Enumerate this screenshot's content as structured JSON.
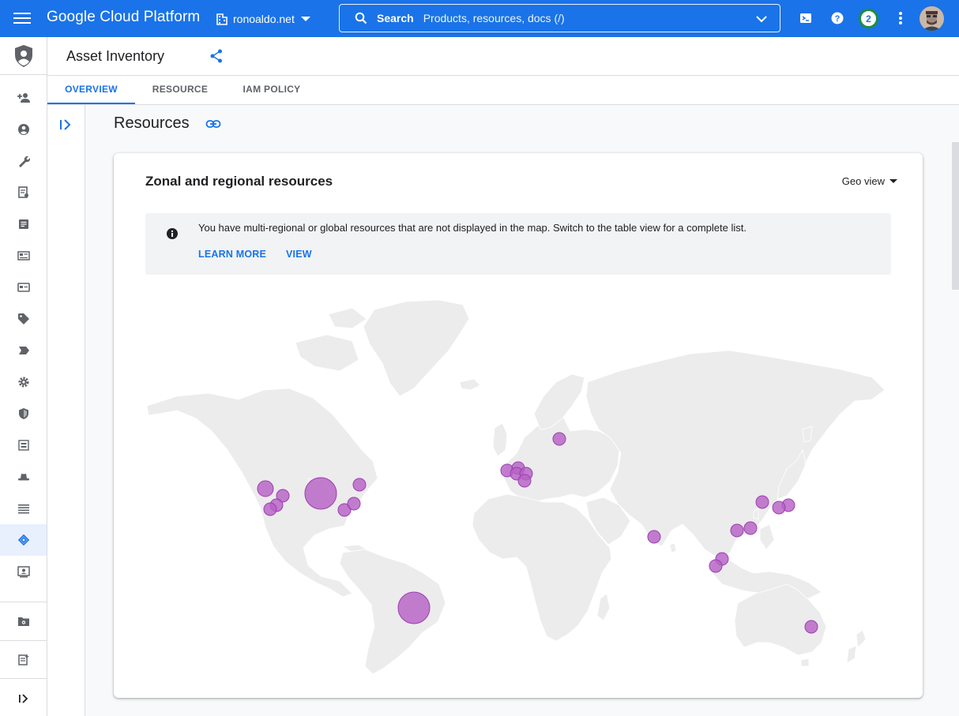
{
  "topbar": {
    "brand": "Google Cloud Platform",
    "project": "ronoaldo.net",
    "search_label": "Search",
    "search_placeholder": "Products, resources, docs (/)",
    "notifications_count": "2",
    "icons": [
      "menu-icon",
      "building-icon",
      "search-icon",
      "chevron-down-icon",
      "cloud-shell-icon",
      "help-icon",
      "more-vert-icon",
      "avatar"
    ]
  },
  "rail": {
    "items": [
      "add-person-icon",
      "account-icon",
      "wrench-icon",
      "audit-icon",
      "list-doc-icon",
      "id-card-icon",
      "card-icon",
      "tag-icon",
      "label-icon",
      "settings-icon",
      "shield-icon",
      "group-icon",
      "hat-icon",
      "list-icon",
      "asset-inventory-icon",
      "contact-card-icon",
      "folder-settings-icon",
      "release-notes-icon",
      "collapse-icon"
    ],
    "active_index": 14
  },
  "header": {
    "title": "Asset Inventory"
  },
  "tabs": [
    {
      "label": "OVERVIEW",
      "active": true
    },
    {
      "label": "RESOURCE",
      "active": false
    },
    {
      "label": "IAM POLICY",
      "active": false
    }
  ],
  "main": {
    "section_title": "Resources"
  },
  "card": {
    "title": "Zonal and regional resources",
    "view_selector": "Geo view",
    "notice": {
      "message": "You have multi-regional or global resources that are not displayed in the map. Switch to the table view for a complete list.",
      "learn_more": "LEARN MORE",
      "view": "VIEW"
    }
  },
  "map": {
    "bubble_color": "#b762c6",
    "bubbles": [
      {
        "region": "us-west1",
        "size": "medium"
      },
      {
        "region": "us-west2",
        "size": "small"
      },
      {
        "region": "us-west3",
        "size": "small"
      },
      {
        "region": "us-west4",
        "size": "small"
      },
      {
        "region": "us-central1",
        "size": "large"
      },
      {
        "region": "us-east1",
        "size": "small"
      },
      {
        "region": "us-east4",
        "size": "small"
      },
      {
        "region": "northamerica-northeast1",
        "size": "small"
      },
      {
        "region": "southamerica-east1",
        "size": "large"
      },
      {
        "region": "europe-north1",
        "size": "small"
      },
      {
        "region": "europe-west2",
        "size": "small"
      },
      {
        "region": "europe-west4",
        "size": "small"
      },
      {
        "region": "europe-west1",
        "size": "small"
      },
      {
        "region": "europe-west3",
        "size": "small"
      },
      {
        "region": "europe-west6",
        "size": "small"
      },
      {
        "region": "asia-south1",
        "size": "small"
      },
      {
        "region": "asia-east2",
        "size": "small"
      },
      {
        "region": "asia-east1",
        "size": "small"
      },
      {
        "region": "asia-northeast3",
        "size": "small"
      },
      {
        "region": "asia-northeast1",
        "size": "small"
      },
      {
        "region": "asia-northeast2",
        "size": "small"
      },
      {
        "region": "asia-southeast1",
        "size": "small"
      },
      {
        "region": "asia-southeast2",
        "size": "small"
      },
      {
        "region": "australia-southeast1",
        "size": "small"
      }
    ]
  }
}
